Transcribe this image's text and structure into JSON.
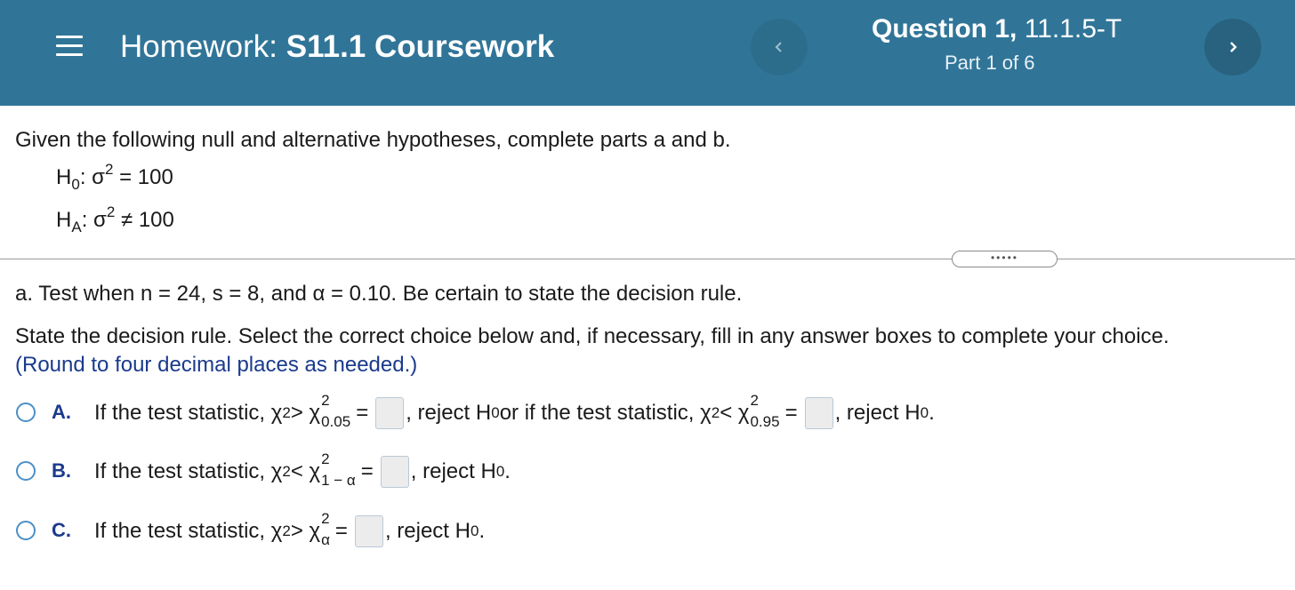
{
  "header": {
    "menu_icon": "hamburger-menu-icon",
    "homework_prefix": "Homework:",
    "homework_name": "S11.1 Coursework",
    "question_prefix": "Question 1,",
    "question_id": "11.1.5-T",
    "part": "Part 1 of 6",
    "prev_icon": "chevron-left-icon",
    "next_icon": "chevron-right-icon",
    "colors": {
      "bar": "#307598",
      "prev_button": "#2d6d8c",
      "next_button": "#28627f"
    }
  },
  "question": {
    "intro": "Given the following null and alternative hypotheses, complete parts a and b.",
    "h0": {
      "H": "H",
      "sub": "0",
      "sep": ": σ",
      "sup": "2",
      "rel": " = 100"
    },
    "ha": {
      "H": "H",
      "sub": "A",
      "sep": ": σ",
      "sup": "2",
      "rel": " ≠ 100"
    },
    "expand_dots": "•••••",
    "part_a": "a. Test when n = 24, s = 8, and α = 0.10. Be certain to state the decision rule.",
    "instruction": "State the decision rule. Select the correct choice below and, if necessary, fill in any answer boxes to complete your choice.",
    "rounding_note": "(Round to four decimal places as needed.)"
  },
  "choices": [
    {
      "letter": "A.",
      "t1": "If the test statistic, χ",
      "sq": "2",
      "op1": " > χ",
      "crit1_sup": "2",
      "crit1_sub": "0.05",
      "eq": " =",
      "t2": ", reject H",
      "h_sub": "0",
      "t3": " or if the test statistic, χ",
      "op2": " < χ",
      "crit2_sup": "2",
      "crit2_sub": "0.95",
      "t4": ", reject H",
      "end": "."
    },
    {
      "letter": "B.",
      "t1": "If the test statistic, χ",
      "sq": "2",
      "op1": " < χ",
      "crit1_sup": "2",
      "crit1_sub": "1 − α",
      "eq": " =",
      "t2": ", reject H",
      "h_sub": "0",
      "end": "."
    },
    {
      "letter": "C.",
      "t1": "If the test statistic, χ",
      "sq": "2",
      "op1": " > χ",
      "crit1_sup": "2",
      "crit1_sub": "α",
      "eq": " =",
      "t2": ", reject H",
      "h_sub": "0",
      "end": "."
    }
  ]
}
